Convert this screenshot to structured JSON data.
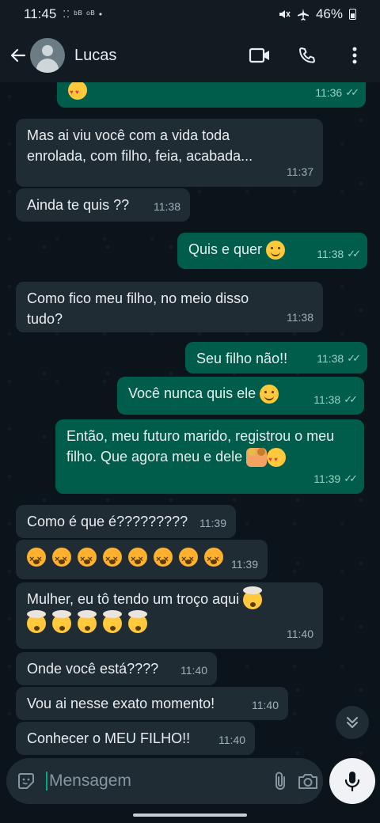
{
  "status_bar": {
    "time": "11:45",
    "left_icons": "⁚⁚ ᵇᴮ ᵒᴮ •",
    "battery": "46%"
  },
  "header": {
    "contact_name": "Lucas"
  },
  "messages": [
    {
      "dir": "out",
      "text": "",
      "emoji": "love",
      "time": "11:36"
    },
    {
      "dir": "in",
      "text": "Mas ai viu você com a vida toda enrolada, com filho, feia, acabada...",
      "time": "11:37"
    },
    {
      "dir": "in",
      "text": "Ainda te quis ??",
      "time": "11:38"
    },
    {
      "dir": "out",
      "text": "Quis e quer",
      "emoji": "smile",
      "time": "11:38"
    },
    {
      "dir": "in",
      "text": "Como fico meu filho, no meio disso tudo?",
      "time": "11:38"
    },
    {
      "dir": "out",
      "text": "Seu filho não!!",
      "time": "11:38"
    },
    {
      "dir": "out",
      "text": "Você nunca quis ele",
      "emoji": "smile",
      "time": "11:38"
    },
    {
      "dir": "out",
      "text": "Então, meu futuro marido, registrou o meu filho. Que agora meu e dele",
      "emoji": "couple+love",
      "time": "11:39"
    },
    {
      "dir": "in",
      "text": "Como é que é?????????",
      "time": "11:39"
    },
    {
      "dir": "in",
      "text": "",
      "emoji": "dizzy x8",
      "time": "11:39"
    },
    {
      "dir": "in",
      "text": "Mulher, eu tô tendo um troço aqui",
      "emoji": "mind-blown x6",
      "time": "11:40"
    },
    {
      "dir": "in",
      "text": "Onde você está????",
      "time": "11:40"
    },
    {
      "dir": "in",
      "text": "Vou ai nesse exato momento!",
      "time": "11:40"
    },
    {
      "dir": "in",
      "text": "Conhecer o MEU FILHO!!",
      "time": "11:40"
    }
  ],
  "composer": {
    "placeholder": "Mensagem"
  },
  "colors": {
    "incoming_bubble": "#1f2c34",
    "outgoing_bubble": "#005c4b",
    "background": "#0b141a",
    "accent": "#00a884"
  }
}
